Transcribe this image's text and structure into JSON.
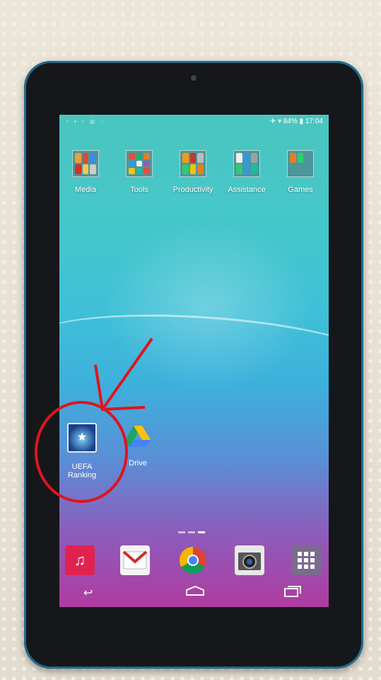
{
  "status": {
    "battery": "84%",
    "time": "17:04"
  },
  "folders": [
    {
      "label": "Media"
    },
    {
      "label": "Tools"
    },
    {
      "label": "Productivity"
    },
    {
      "label": "Assistance"
    },
    {
      "label": "Games"
    }
  ],
  "apps": {
    "uefa_line1": "UEFA",
    "uefa_line2": "Ranking",
    "drive": "Drive"
  },
  "dock": [
    {
      "icon": "music-icon",
      "color": "#e0234e"
    },
    {
      "icon": "gmail-icon",
      "color": "#c9302c"
    },
    {
      "icon": "chrome-icon",
      "color": "#4caf50"
    },
    {
      "icon": "camera-icon",
      "color": "#333a44"
    },
    {
      "icon": "apps-grid-icon",
      "color": "#7b6b8f"
    }
  ],
  "pages": {
    "count": 3,
    "current": 3
  },
  "colors": {
    "annotation": "#e0141e"
  }
}
